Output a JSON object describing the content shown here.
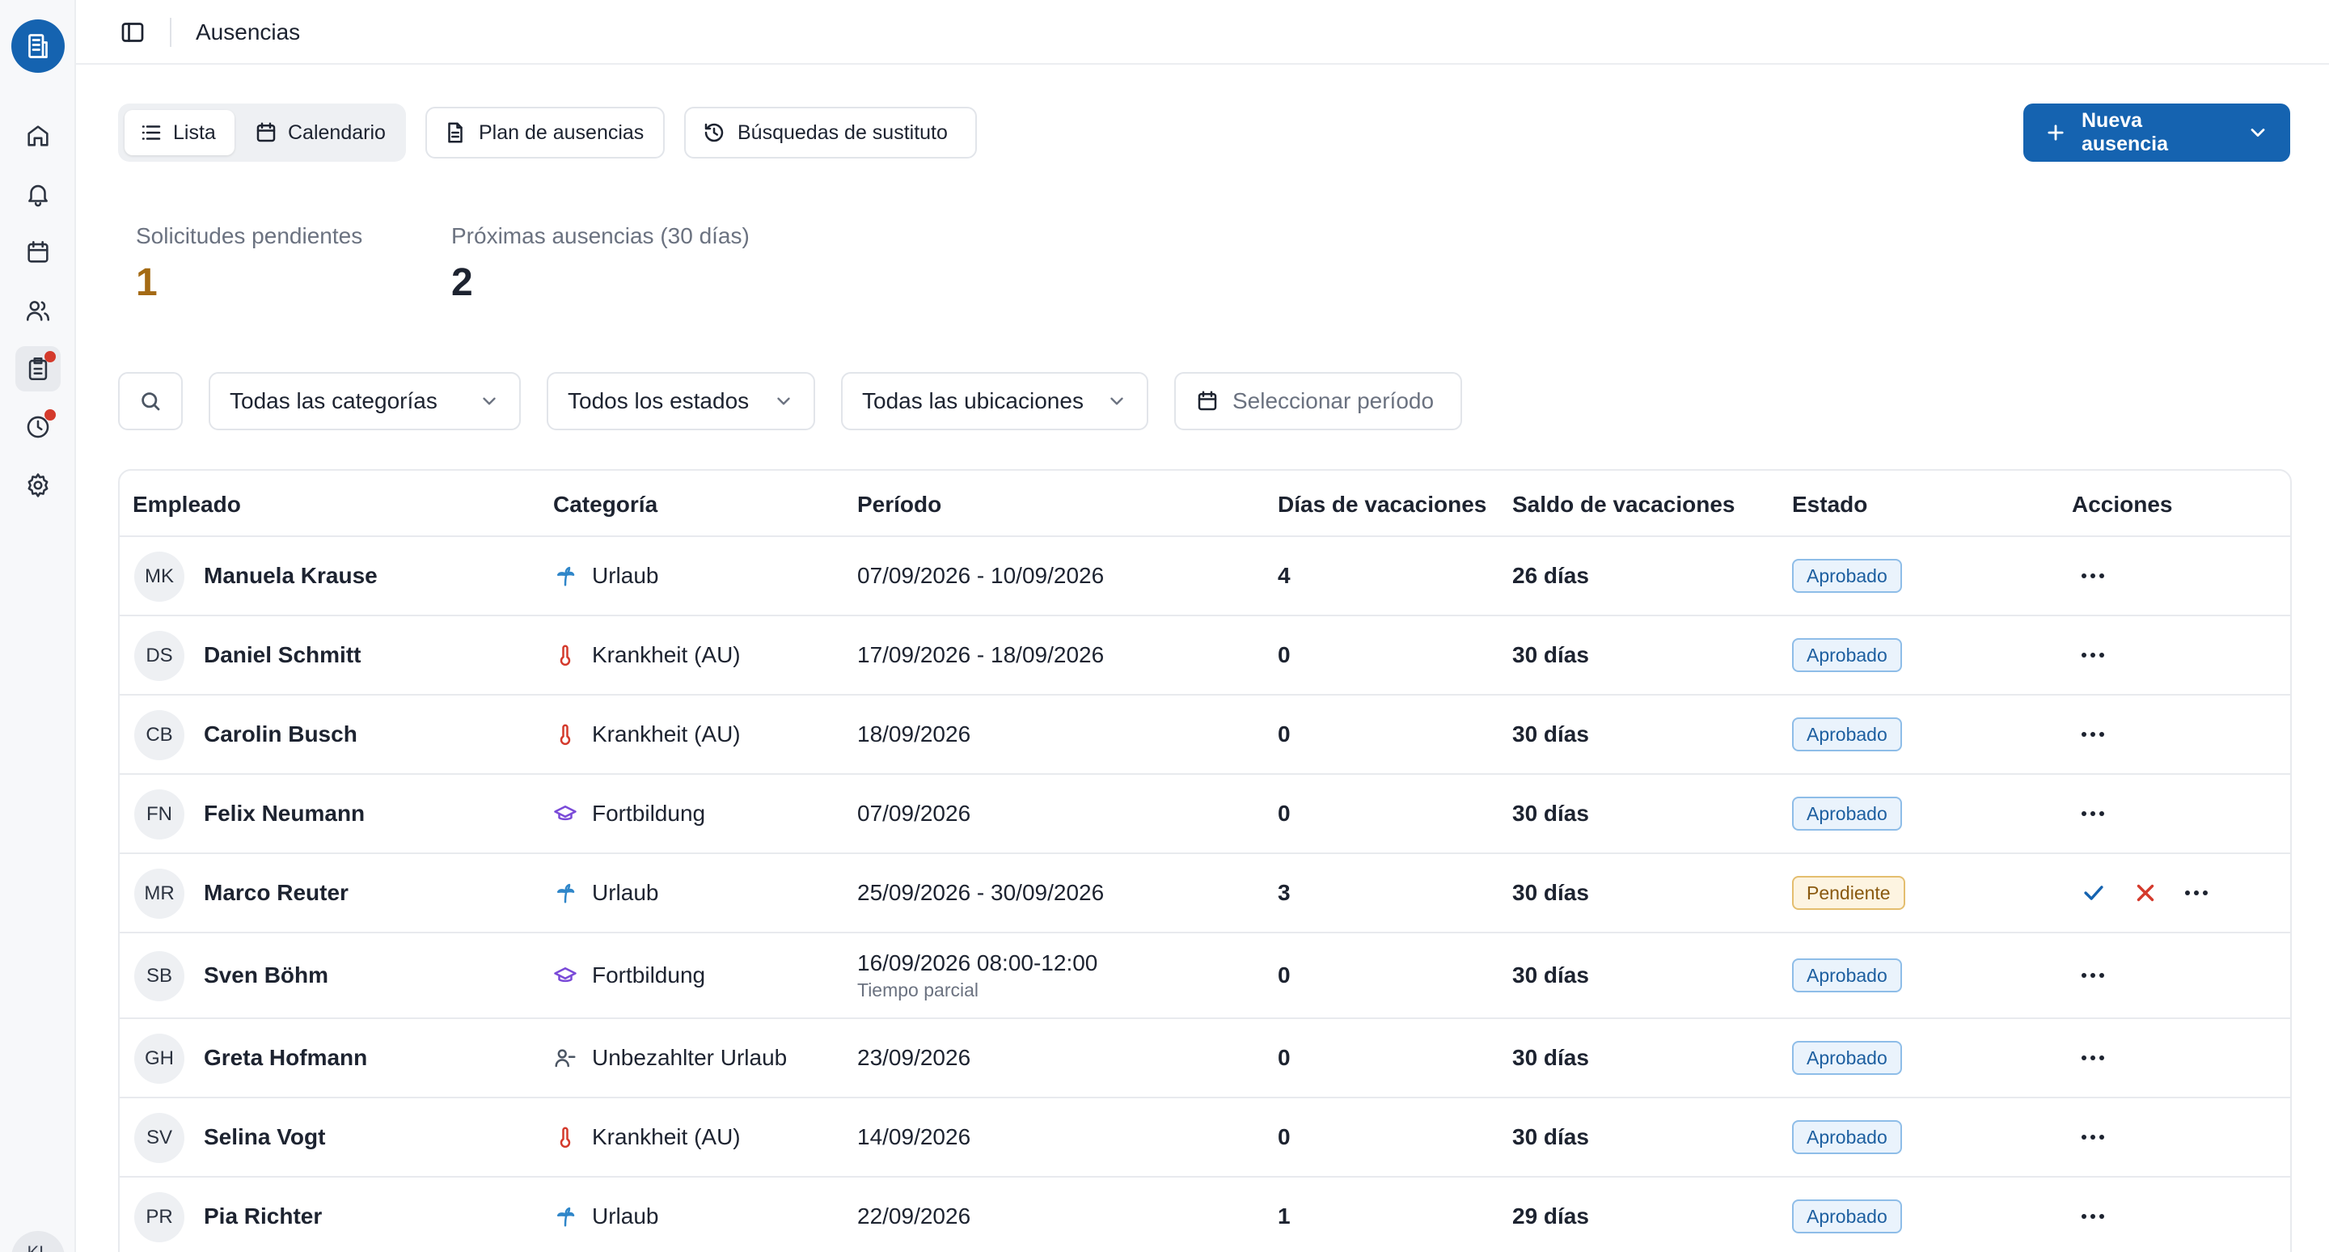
{
  "header": {
    "title": "Ausencias"
  },
  "sidebar": {
    "user_initials": "KL"
  },
  "toolbar": {
    "tab_list": "Lista",
    "tab_calendar": "Calendario",
    "plan_button": "Plan de ausencias",
    "substitute_button": "Búsquedas de sustituto",
    "new_button": "Nueva ausencia"
  },
  "stats": {
    "pending_label": "Solicitudes pendientes",
    "pending_value": "1",
    "upcoming_label": "Próximas ausencias (30 días)",
    "upcoming_value": "2"
  },
  "filters": {
    "category": "Todas las categorías",
    "status": "Todos los estados",
    "location": "Todas las ubicaciones",
    "period_placeholder": "Seleccionar período"
  },
  "table": {
    "columns": [
      "Empleado",
      "Categoría",
      "Período",
      "Días de vacaciones",
      "Saldo de vacaciones",
      "Estado",
      "Acciones"
    ],
    "rows": [
      {
        "initials": "MK",
        "name": "Manuela Krause",
        "category": "Urlaub",
        "period": "07/09/2026 - 10/09/2026",
        "period_sub": "",
        "days": "4",
        "balance": "26 días",
        "status": "Aprobado"
      },
      {
        "initials": "DS",
        "name": "Daniel Schmitt",
        "category": "Krankheit (AU)",
        "period": "17/09/2026 - 18/09/2026",
        "period_sub": "",
        "days": "0",
        "balance": "30 días",
        "status": "Aprobado"
      },
      {
        "initials": "CB",
        "name": "Carolin Busch",
        "category": "Krankheit (AU)",
        "period": "18/09/2026",
        "period_sub": "",
        "days": "0",
        "balance": "30 días",
        "status": "Aprobado"
      },
      {
        "initials": "FN",
        "name": "Felix Neumann",
        "category": "Fortbildung",
        "period": "07/09/2026",
        "period_sub": "",
        "days": "0",
        "balance": "30 días",
        "status": "Aprobado"
      },
      {
        "initials": "MR",
        "name": "Marco Reuter",
        "category": "Urlaub",
        "period": "25/09/2026 - 30/09/2026",
        "period_sub": "",
        "days": "3",
        "balance": "30 días",
        "status": "Pendiente"
      },
      {
        "initials": "SB",
        "name": "Sven Böhm",
        "category": "Fortbildung",
        "period": "16/09/2026 08:00-12:00",
        "period_sub": "Tiempo parcial",
        "days": "0",
        "balance": "30 días",
        "status": "Aprobado"
      },
      {
        "initials": "GH",
        "name": "Greta Hofmann",
        "category": "Unbezahlter Urlaub",
        "period": "23/09/2026",
        "period_sub": "",
        "days": "0",
        "balance": "30 días",
        "status": "Aprobado"
      },
      {
        "initials": "SV",
        "name": "Selina Vogt",
        "category": "Krankheit (AU)",
        "period": "14/09/2026",
        "period_sub": "",
        "days": "0",
        "balance": "30 días",
        "status": "Aprobado"
      },
      {
        "initials": "PR",
        "name": "Pia Richter",
        "category": "Urlaub",
        "period": "22/09/2026",
        "period_sub": "",
        "days": "1",
        "balance": "29 días",
        "status": "Aprobado"
      }
    ]
  },
  "icons": {
    "Urlaub": "palm-tree-icon",
    "Krankheit (AU)": "thermometer-icon",
    "Fortbildung": "graduation-cap-icon",
    "Unbezahlter Urlaub": "user-minus-icon"
  },
  "colors": {
    "primary": "#1563b0",
    "pending_stat": "#a46a14",
    "badge_approved": "#1d5fa0",
    "badge_pending": "#8a5a10"
  }
}
